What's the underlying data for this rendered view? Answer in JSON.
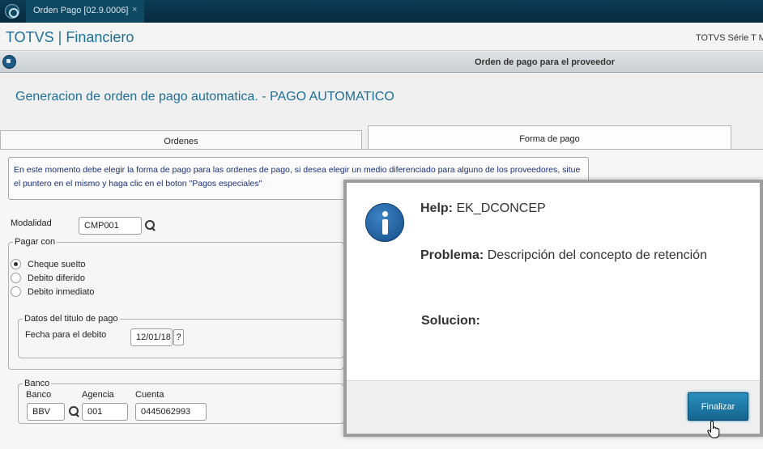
{
  "topbar": {
    "tab_label": "Orden Pago [02.9.0006]",
    "close_glyph": "×"
  },
  "app": {
    "title": "TOTVS | Financiero",
    "right_text": "TOTVS Série T M"
  },
  "window": {
    "title": "Orden de pago para el proveedor"
  },
  "page": {
    "subtitle": "Generacion de orden de pago automatica. - PAGO AUTOMATICO"
  },
  "tabs": [
    {
      "label": "Ordenes",
      "active": false
    },
    {
      "label": "Forma de pago",
      "active": true
    }
  ],
  "info_text": "En este momento debe elegir la forma de pago para las ordenes de pago, si desea elegir un medio diferenciado para alguno de los proveedores, situe el puntero en el mismo y haga clic en el boton \"Pagos especiales\"",
  "modalidad": {
    "label": "Modalidad",
    "value": "CMP001"
  },
  "pagar_con": {
    "title": "Pagar con",
    "options": [
      {
        "label": "Cheque sueIto",
        "selected": true
      },
      {
        "label": "Debito diferido",
        "selected": false
      },
      {
        "label": "Debito inmediato",
        "selected": false
      }
    ]
  },
  "datos_titulo": {
    "title": "Datos del titulo de pago",
    "fecha_label": "Fecha para el debito",
    "fecha_value": "12/01/18",
    "help_button": "?"
  },
  "banco": {
    "title": "Banco",
    "banco_label": "Banco",
    "banco_value": "BBV",
    "agencia_label": "Agencia",
    "agencia_value": "001",
    "cuenta_label": "Cuenta",
    "cuenta_value": "0445062993"
  },
  "help_dialog": {
    "help_label": "Help:",
    "help_value": "EK_DCONCEP",
    "problema_label": "Problema:",
    "problema_value": "Descripción del concepto de retención",
    "solucion_label": "Solucion:",
    "button_label": "Finalizar",
    "icon": "info-icon"
  },
  "colors": {
    "brand": "#1e6f98",
    "topbar": "#062b3f",
    "button": "#14658f"
  }
}
